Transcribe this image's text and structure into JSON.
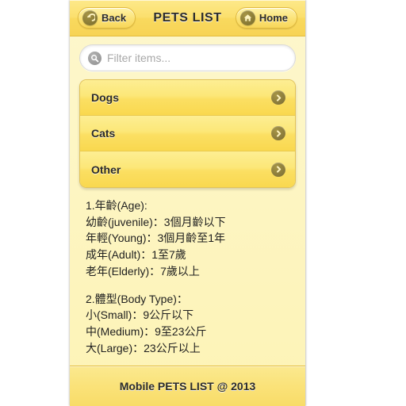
{
  "header": {
    "title": "PETS LIST",
    "back_label": "Back",
    "back_icon": "back-arrow-icon",
    "home_label": "Home",
    "home_icon": "home-icon"
  },
  "search": {
    "placeholder": "Filter items...",
    "value": "",
    "icon": "search-icon"
  },
  "list": {
    "items": [
      {
        "label": "Dogs",
        "icon": "chevron-right-icon"
      },
      {
        "label": "Cats",
        "icon": "chevron-right-icon"
      },
      {
        "label": "Other",
        "icon": "chevron-right-icon"
      }
    ]
  },
  "info": {
    "block1": [
      "1.年齡(Age):",
      "幼齡(juvenile)：3個月齡以下",
      "年輕(Young)：3個月齡至1年",
      "成年(Adult)：1至7歲",
      "老年(Elderly)：7歲以上"
    ],
    "block2": [
      "2.體型(Body Type)：",
      "小(Small)：9公斤以下",
      "中(Medium)：9至23公斤",
      "大(Large)：23公斤以上"
    ]
  },
  "footer": {
    "text": "Mobile PETS LIST @ 2013"
  },
  "colors": {
    "header_bar": "#fbdf6d",
    "page_background": "#fdf4bd",
    "list_item": "#fce778",
    "icon_circle": "#87783a",
    "text": "#2b2b2b"
  }
}
